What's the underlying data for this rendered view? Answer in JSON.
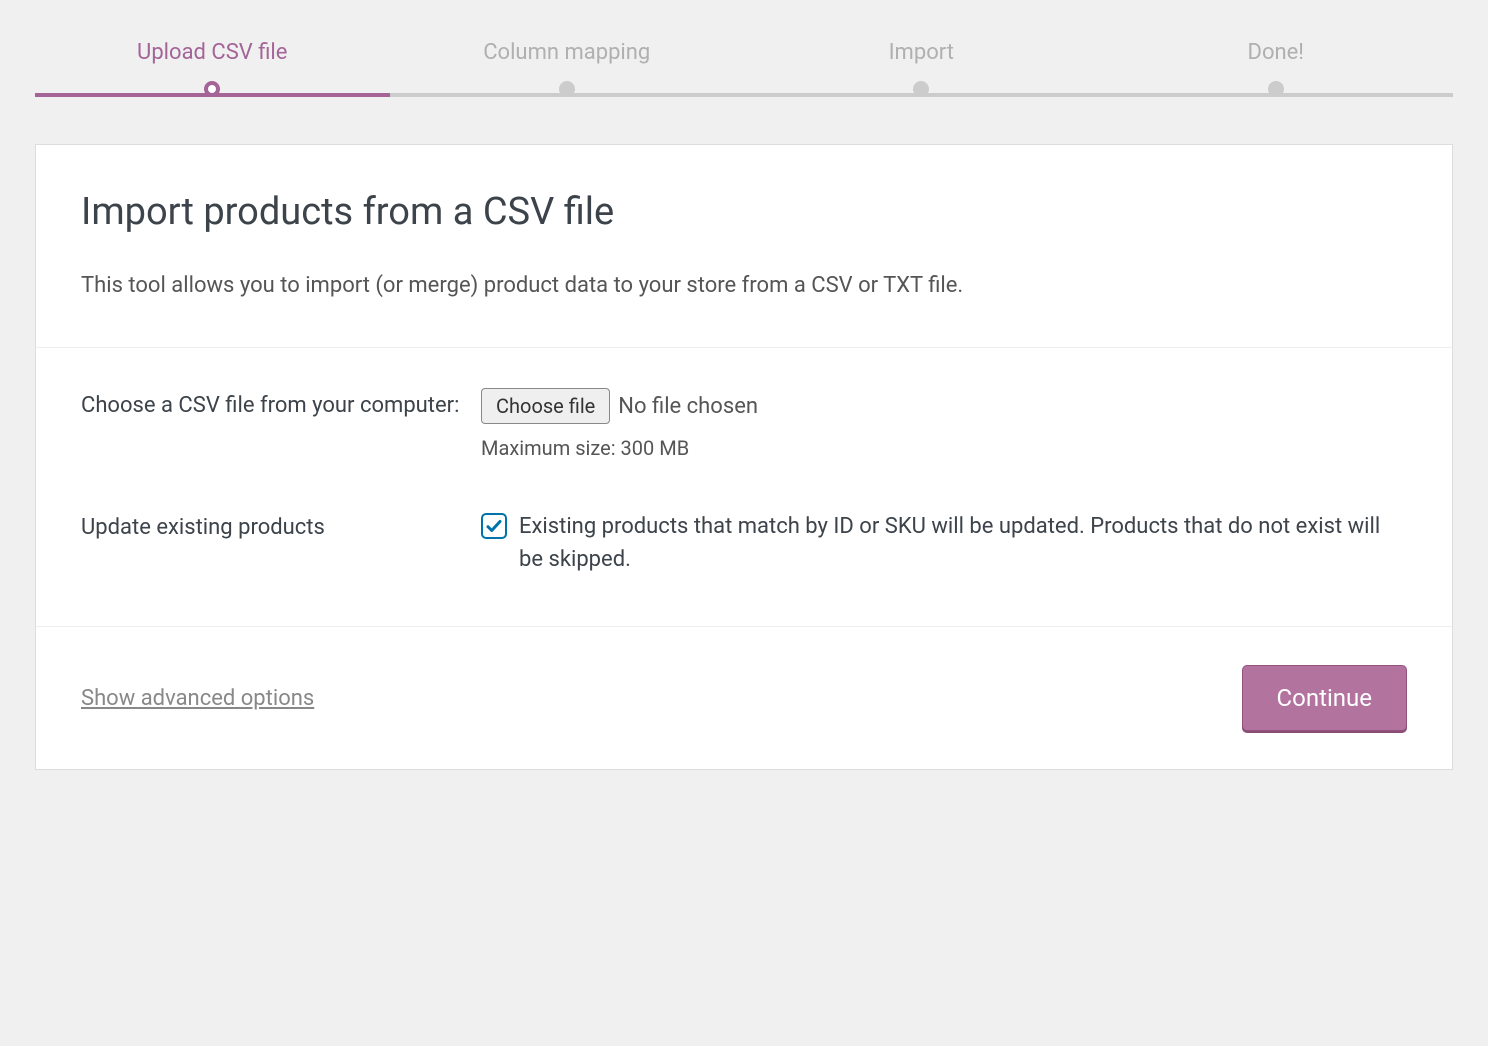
{
  "stepper": {
    "steps": [
      {
        "label": "Upload CSV file",
        "active": true
      },
      {
        "label": "Column mapping",
        "active": false
      },
      {
        "label": "Import",
        "active": false
      },
      {
        "label": "Done!",
        "active": false
      }
    ]
  },
  "header": {
    "title": "Import products from a CSV file",
    "subtitle": "This tool allows you to import (or merge) product data to your store from a CSV or TXT file."
  },
  "form": {
    "file_field": {
      "label": "Choose a CSV file from your computer:",
      "button": "Choose file",
      "status": "No file chosen",
      "hint": "Maximum size: 300 MB"
    },
    "update_field": {
      "label": "Update existing products",
      "checked": true,
      "description": "Existing products that match by ID or SKU will be updated. Products that do not exist will be skipped."
    }
  },
  "footer": {
    "advanced_link": "Show advanced options",
    "continue_button": "Continue"
  }
}
